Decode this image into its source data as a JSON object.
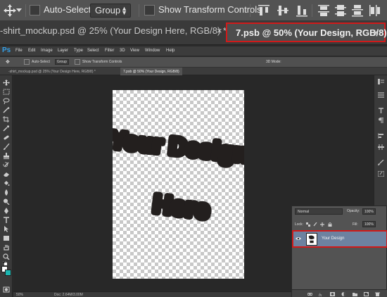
{
  "options_bar": {
    "auto_select_label": "Auto-Select:",
    "auto_select_value": "Group",
    "show_transform_label": "Show Transform Controls"
  },
  "document_tabs": [
    {
      "label": "-shirt_mockup.psd @ 25% (Your Design Here, RGB/8) *",
      "close": "×"
    },
    {
      "label": "7.psb @ 50% (Your Design, RGB/8)",
      "close": "×"
    }
  ],
  "app": {
    "logo": "Ps",
    "menu": [
      "File",
      "Edit",
      "Image",
      "Layer",
      "Type",
      "Select",
      "Filter",
      "3D",
      "View",
      "Window",
      "Help"
    ],
    "options": {
      "auto_select_label": "Auto-Select",
      "auto_select_value": "Group",
      "show_transform_label": "Show Transform Controls",
      "mode_3d": "3D Mode:"
    },
    "tabs": [
      {
        "label": "-shirt_mockup.psd @ 25% (Your Design Here, RGB/8) *"
      },
      {
        "label": "7.psb @ 50% (Your Design, RGB/8)"
      }
    ],
    "status": {
      "zoom": "50%",
      "doc": "Doc: 2.64M/3.00M"
    }
  },
  "canvas": {
    "artwork_text_line1": "Your Design",
    "artwork_text_line2": "Here"
  },
  "colors": {
    "foreground": "#ffffff",
    "background": "#1bb5b0",
    "highlight": "#d11a1a",
    "selected_layer": "#6d82a0"
  },
  "layers": {
    "blend_mode": "Normal",
    "opacity_label": "Opacity:",
    "opacity_value": "100%",
    "lock_label": "Lock:",
    "fill_label": "Fill:",
    "fill_value": "100%",
    "items": [
      {
        "name": "Your Design",
        "visible": true,
        "selected": true
      }
    ]
  }
}
